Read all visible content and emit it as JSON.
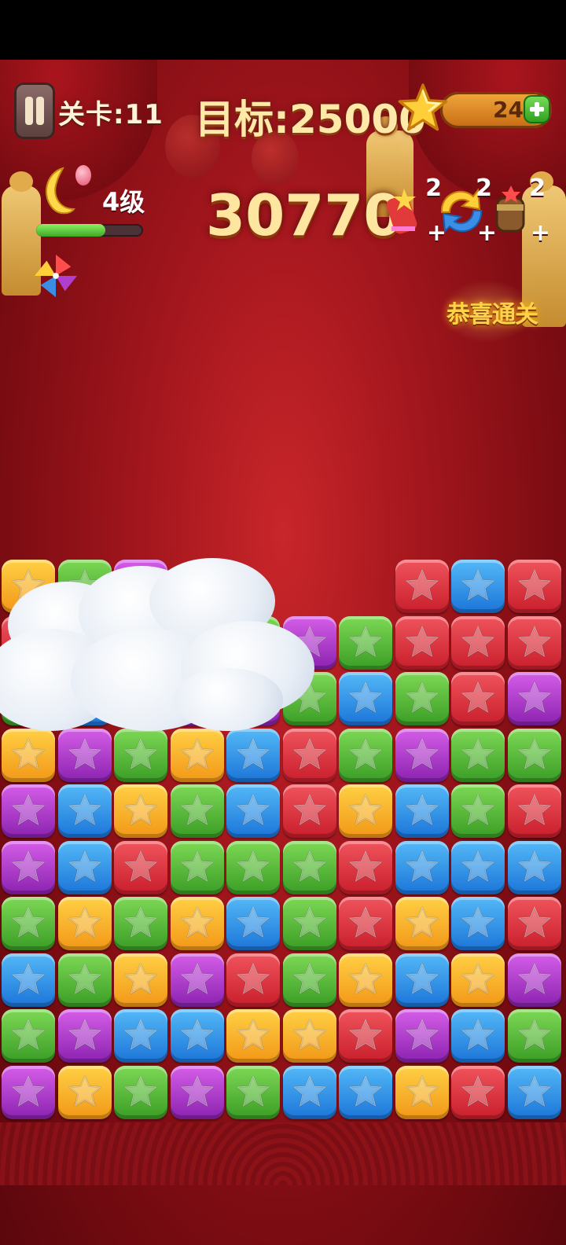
{
  "header": {
    "level_label": "关卡:11",
    "goal_label": "目标:25000",
    "star_count": "24",
    "score": "30770",
    "rank_label": "4级",
    "rank_progress": 0.65,
    "clear_badge": "恭喜通关"
  },
  "tools": [
    {
      "name": "magic-wand",
      "count": "2",
      "plus": "+"
    },
    {
      "name": "refresh",
      "count": "2",
      "plus": "+"
    },
    {
      "name": "hammer",
      "count": "2",
      "plus": "+"
    }
  ],
  "icons": [
    "pause-icon",
    "moon-icon",
    "pinwheel-icon",
    "star-icon",
    "plus-icon"
  ],
  "colors": {
    "red": "#e03a44",
    "blue": "#2f8ee6",
    "green": "#56b83a",
    "yellow": "#f9b62a",
    "purple": "#b03fcf"
  },
  "board": {
    "columns": 10,
    "rows": [
      [
        "yellow",
        "green",
        "purple",
        "empty",
        "empty",
        "empty",
        "empty",
        "red",
        "blue",
        "red"
      ],
      [
        "red",
        "green",
        "blue",
        "red",
        "green",
        "purple",
        "green",
        "red",
        "red",
        "red"
      ],
      [
        "green",
        "blue",
        "yellow",
        "purple",
        "purple",
        "green",
        "blue",
        "green",
        "red",
        "purple"
      ],
      [
        "yellow",
        "purple",
        "green",
        "yellow",
        "blue",
        "red",
        "green",
        "purple",
        "green",
        "green"
      ],
      [
        "purple",
        "blue",
        "yellow",
        "green",
        "blue",
        "red",
        "yellow",
        "blue",
        "green",
        "red"
      ],
      [
        "purple",
        "blue",
        "red",
        "green",
        "green",
        "green",
        "red",
        "blue",
        "blue",
        "blue"
      ],
      [
        "green",
        "yellow",
        "green",
        "yellow",
        "blue",
        "green",
        "red",
        "yellow",
        "blue",
        "red"
      ],
      [
        "blue",
        "green",
        "yellow",
        "purple",
        "red",
        "green",
        "yellow",
        "blue",
        "yellow",
        "purple"
      ],
      [
        "green",
        "purple",
        "blue",
        "blue",
        "yellow",
        "yellow",
        "red",
        "purple",
        "blue",
        "green"
      ],
      [
        "purple",
        "yellow",
        "green",
        "purple",
        "green",
        "blue",
        "blue",
        "yellow",
        "red",
        "blue"
      ]
    ]
  }
}
